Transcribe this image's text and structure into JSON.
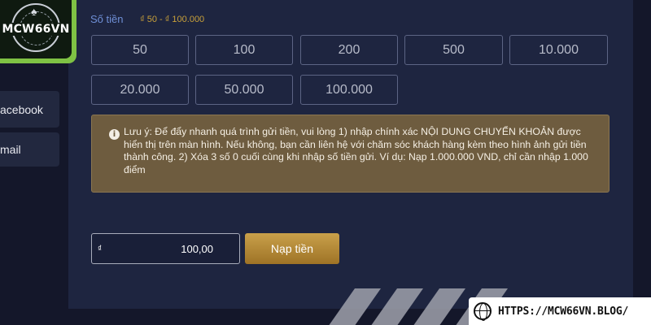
{
  "logo": {
    "text": "MCW66VN"
  },
  "sidebar": {
    "items": [
      {
        "label": "acebook"
      },
      {
        "label": "mail"
      }
    ]
  },
  "deposit": {
    "amount_label": "Số tiền",
    "amount_range": "₫ 50 - ₫ 100.000",
    "quick_amounts": [
      "50",
      "100",
      "200",
      "500",
      "10.000",
      "20.000",
      "50.000",
      "100.000"
    ],
    "notice": {
      "icon": "info-icon",
      "text": "Lưu ý: Để đẩy nhanh quá trình gửi tiền, vui lòng 1) nhập chính xác NỘI DUNG CHUYỂN KHOẢN được hiển thị trên màn hình. Nếu không, bạn cần liên hệ với chăm sóc khách hàng kèm theo hình ảnh gửi tiền thành công. 2) Xóa 3 số 0 cuối cùng khi nhập số tiền gửi. Ví dụ: Nạp 1.000.000 VND, chỉ cần nhập 1.000 điểm"
    },
    "input": {
      "currency_symbol": "₫",
      "value": "100,00"
    },
    "submit_label": "Nạp tiền"
  },
  "watermark": {
    "url": "HTTPS://MCW66VN.BLOG/",
    "icon": "globe-icon"
  },
  "colors": {
    "background": "#14172a",
    "panel": "#1e2540",
    "accent_gold": "#c9a04a",
    "notice_bg": "#6e5c3f",
    "logo_green": "#7fc244"
  }
}
